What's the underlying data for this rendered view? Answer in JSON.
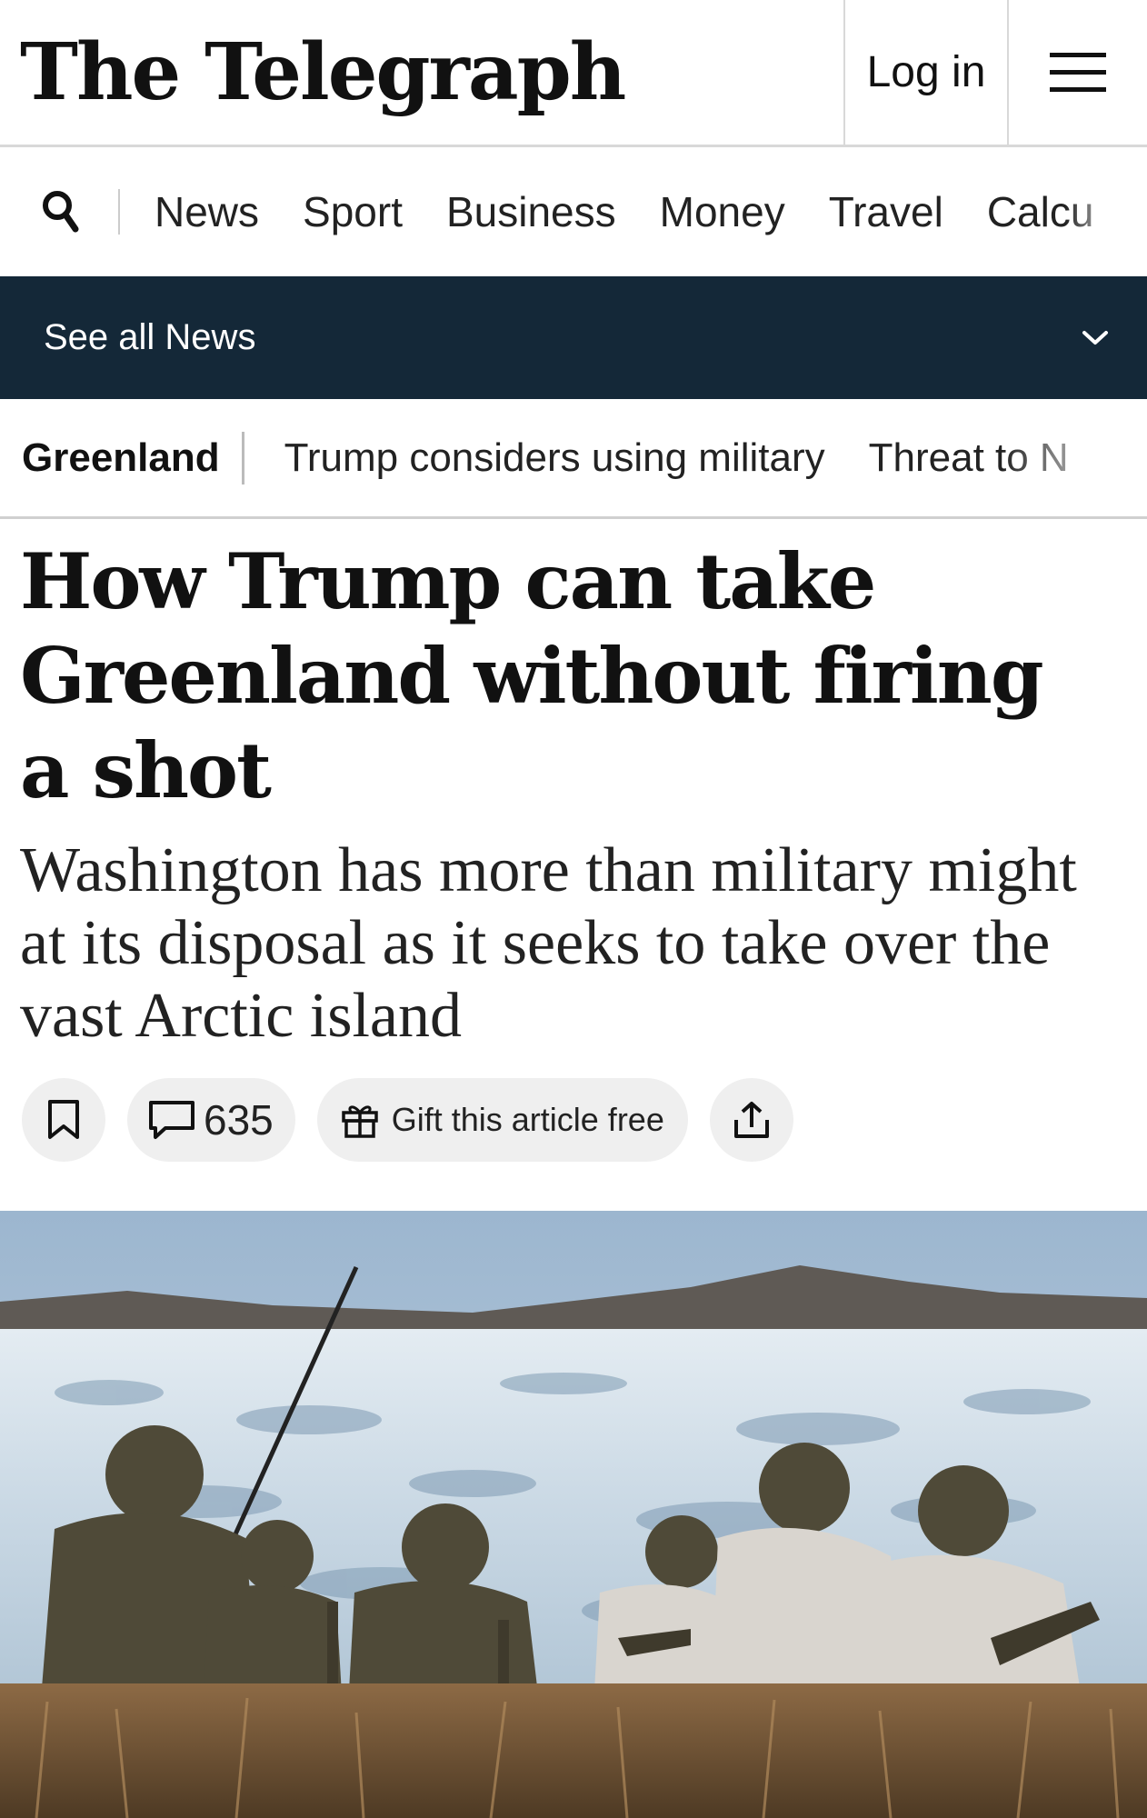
{
  "masthead": {
    "logo_text": "The Telegraph",
    "login_label": "Log in"
  },
  "icons": {
    "menu": "hamburger-menu-icon",
    "search": "search-icon",
    "chevron": "chevron-down-icon",
    "bookmark": "bookmark-icon",
    "comment": "speech-bubble-icon",
    "gift": "gift-icon",
    "share": "share-icon"
  },
  "section_nav": {
    "items": [
      "News",
      "Sport",
      "Business",
      "Money",
      "Travel",
      "Calcu"
    ]
  },
  "see_all": {
    "label": "See all News"
  },
  "topics": {
    "current": "Greenland",
    "items": [
      "Trump considers using military",
      "Threat to N"
    ]
  },
  "article": {
    "headline": "How Trump can take Greenland without firing a shot",
    "standfirst": "Washington has more than military might at its disposal as it seeks to take over the vast Arctic island",
    "comment_count": "635",
    "gift_label": "Gift this article free"
  },
  "colors": {
    "nav_bar": "#142838",
    "pill_bg": "#efefef"
  }
}
